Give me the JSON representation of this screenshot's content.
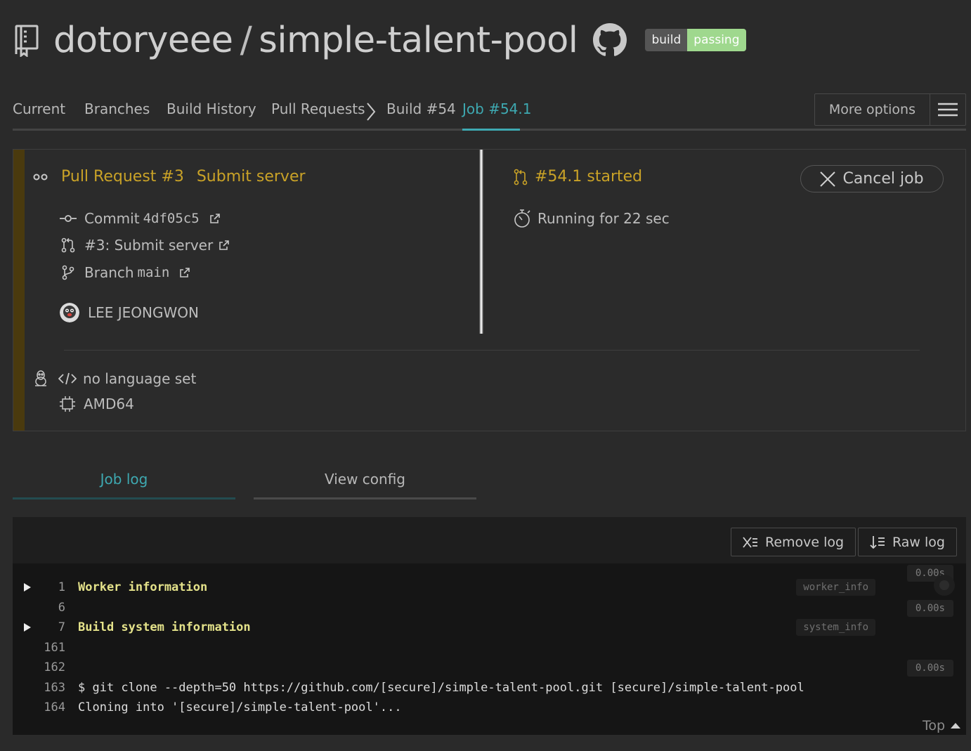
{
  "header": {
    "owner": "dotoryeee",
    "separator": "/",
    "repo": "simple-talent-pool",
    "badge_left": "build",
    "badge_right": "passing"
  },
  "nav": {
    "tabs": [
      {
        "label": "Current"
      },
      {
        "label": "Branches"
      },
      {
        "label": "Build History"
      },
      {
        "label": "Pull Requests"
      },
      {
        "label": "Build #54"
      },
      {
        "label": "Job #54.1"
      }
    ],
    "more_options": "More options"
  },
  "job": {
    "pr_title": "Pull Request #3",
    "pr_message": "Submit server",
    "commit_label": "Commit",
    "commit_sha": "4df05c5",
    "pr_link": "#3: Submit server",
    "branch_label": "Branch",
    "branch_name": "main",
    "author": "LEE JEONGWON",
    "status": "#54.1 started",
    "running": "Running for 22 sec",
    "cancel": "Cancel job",
    "language": "no language set",
    "arch": "AMD64"
  },
  "tabs": {
    "job_log": "Job log",
    "view_config": "View config"
  },
  "log": {
    "remove": "Remove log",
    "raw": "Raw log",
    "top": "Top",
    "lines": [
      {
        "num": "1",
        "text": "Worker information",
        "fold": true,
        "tag": "worker_info"
      },
      {
        "num": "6",
        "text": ""
      },
      {
        "num": "7",
        "text": "Build system information",
        "fold": true,
        "tag": "system_info"
      },
      {
        "num": "161",
        "text": ""
      },
      {
        "num": "162",
        "text": ""
      },
      {
        "num": "163",
        "text": "$ git clone --depth=50 https://github.com/[secure]/simple-talent-pool.git [secure]/simple-talent-pool"
      },
      {
        "num": "164",
        "text": "Cloning into '[secure]/simple-talent-pool'..."
      }
    ],
    "durations": [
      "0.00s",
      "0.00s",
      "0.00s"
    ]
  },
  "colors": {
    "accent": "#3ea9b1",
    "started": "#c9a227",
    "passing": "#9fd88e",
    "stripe": "#4a3a0e"
  }
}
